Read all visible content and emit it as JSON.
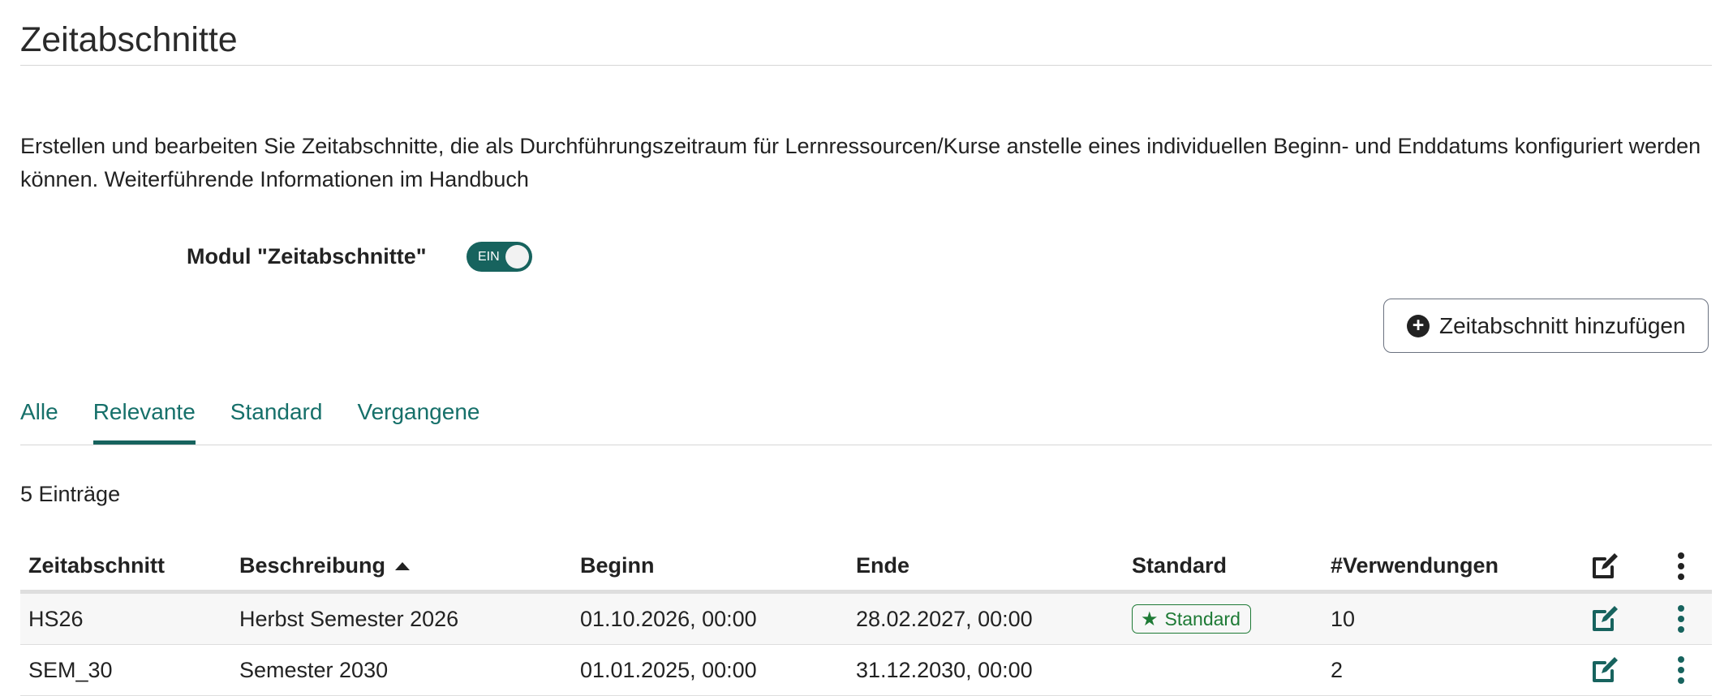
{
  "page": {
    "title": "Zeitabschnitte",
    "description": "Erstellen und bearbeiten Sie Zeitabschnitte, die als Durchführungszeitraum für Lernressourcen/Kurse anstelle eines individuellen Beginn- und Enddatums konfiguriert werden können.",
    "handbook_link": "Weiterführende Informationen im Handbuch"
  },
  "module": {
    "label": "Modul \"Zeitabschnitte\"",
    "toggle_state": "EIN",
    "enabled": true
  },
  "add_button": {
    "label": "Zeitabschnitt hinzufügen",
    "icon": "plus-circle-icon"
  },
  "tabs": [
    {
      "label": "Alle",
      "active": false
    },
    {
      "label": "Relevante",
      "active": true
    },
    {
      "label": "Standard",
      "active": false
    },
    {
      "label": "Vergangene",
      "active": false
    }
  ],
  "entry_count": "5 Einträge",
  "table": {
    "headers": [
      "Zeitabschnitt",
      "Beschreibung",
      "Beginn",
      "Ende",
      "Standard",
      "#Verwendungen"
    ],
    "sorted_column": "Beschreibung",
    "sort_direction": "ascending",
    "rows": [
      {
        "name": "HS26",
        "description": "Herbst Semester 2026",
        "start": "01.10.2026, 00:00",
        "end": "28.02.2027, 00:00",
        "default": "Standard",
        "usages": "10"
      },
      {
        "name": "SEM_30",
        "description": "Semester 2030",
        "start": "01.01.2025, 00:00",
        "end": "31.12.2030, 00:00",
        "default": "",
        "usages": "2"
      }
    ]
  },
  "colors": {
    "accent": "#17635e",
    "tab_text": "#16706a",
    "badge_green": "#1e7a35",
    "divider": "#d6d6d6"
  }
}
